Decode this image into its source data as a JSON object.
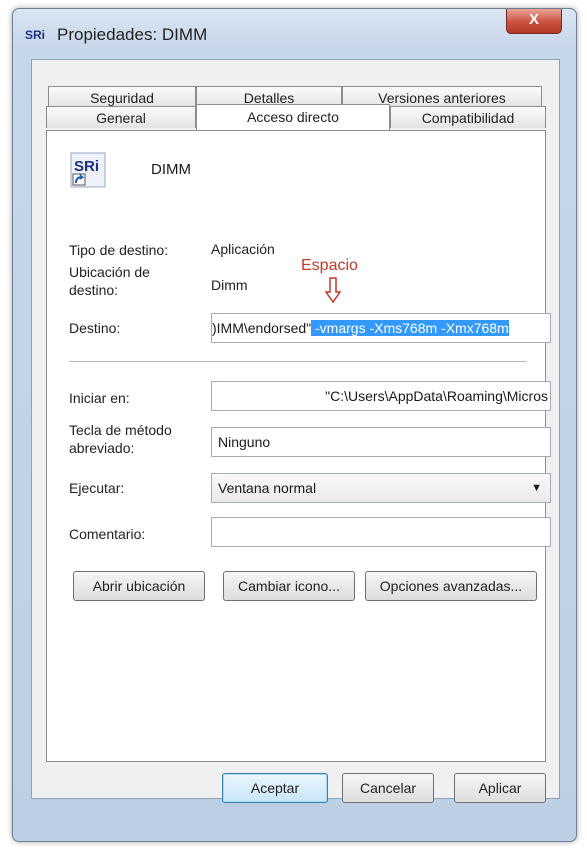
{
  "window": {
    "title": "Propiedades: DIMM",
    "close_glyph": "X",
    "app_icon": "SRi"
  },
  "tabs": {
    "row1": [
      "Seguridad",
      "Detalles",
      "Versiones anteriores"
    ],
    "row2": [
      "General",
      "Acceso directo",
      "Compatibilidad"
    ],
    "active": "Acceso directo"
  },
  "shortcut": {
    "name": "DIMM",
    "target_type_label": "Tipo de destino:",
    "target_type_value": "Aplicación",
    "target_location_label": "Ubicación de destino:",
    "target_location_value": "Dimm",
    "target_label": "Destino:",
    "target_value_plain": ")IMM\\endorsed\"",
    "target_value_highlight": " -vmargs -Xms768m -Xmx768m",
    "annotation": "Espacio",
    "start_in_label": "Iniciar en:",
    "start_in_value": "\"C:\\Users\\AppData\\Roaming\\Micros",
    "hotkey_label": "Tecla de método abreviado:",
    "hotkey_value": "Ninguno",
    "run_label": "Ejecutar:",
    "run_value": "Ventana normal",
    "comment_label": "Comentario:",
    "comment_value": ""
  },
  "buttons": {
    "open_location": "Abrir ubicación",
    "change_icon": "Cambiar icono...",
    "advanced": "Opciones avanzadas...",
    "ok": "Aceptar",
    "cancel": "Cancelar",
    "apply": "Aplicar"
  },
  "colors": {
    "selection": "#3399ff",
    "annotation": "#c0392b",
    "close": "#c9523f"
  }
}
